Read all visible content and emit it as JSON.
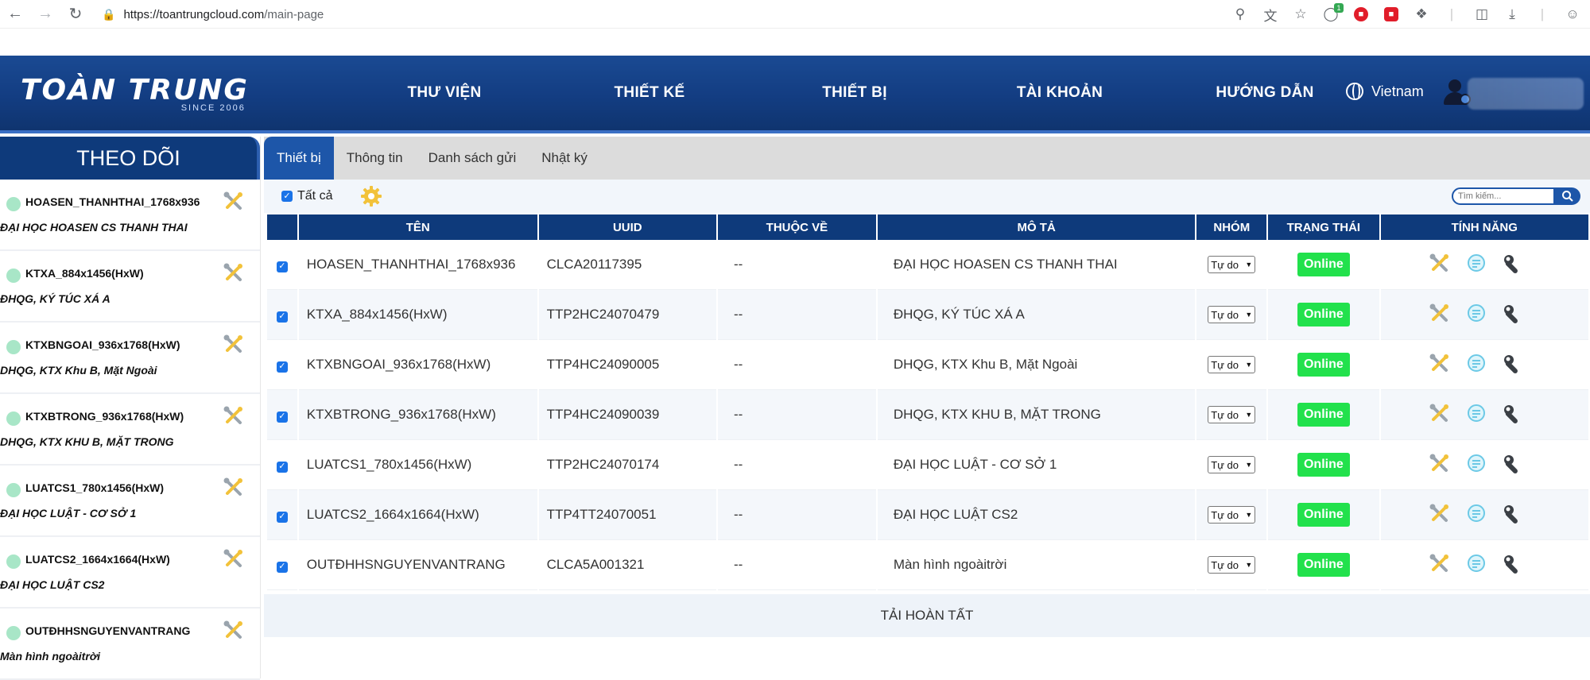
{
  "browser": {
    "url_host": "https://toantrungcloud.com",
    "url_path": "/main-page",
    "ext_badge": "1"
  },
  "header": {
    "logo_main": "TOÀN TRUNG",
    "logo_sub": "SINCE 2006",
    "nav": [
      "THƯ VIỆN",
      "THIẾT KẾ",
      "THIẾT BỊ",
      "TÀI KHOẢN",
      "HƯỚNG DẪN"
    ],
    "language": "Vietnam"
  },
  "sidebar": {
    "title": "THEO DÕI",
    "items": [
      {
        "name": "HOASEN_THANHTHAI_1768x936",
        "desc": "ĐẠI HỌC HOASEN CS THANH THAI"
      },
      {
        "name": "KTXA_884x1456(HxW)",
        "desc": "ĐHQG, KÝ TÚC XÁ A"
      },
      {
        "name": "KTXBNGOAI_936x1768(HxW)",
        "desc": "DHQG, KTX Khu B, Mặt Ngoài"
      },
      {
        "name": "KTXBTRONG_936x1768(HxW)",
        "desc": "DHQG, KTX KHU B, MẶT TRONG"
      },
      {
        "name": "LUATCS1_780x1456(HxW)",
        "desc": "ĐẠI HỌC LUẬT - CƠ SỞ 1"
      },
      {
        "name": "LUATCS2_1664x1664(HxW)",
        "desc": "ĐẠI HỌC LUẬT CS2"
      },
      {
        "name": "OUTĐHHSNGUYENVANTRANG",
        "desc": "Màn hình ngoàitrời"
      }
    ]
  },
  "tabs": [
    "Thiết bị",
    "Thông tin",
    "Danh sách gửi",
    "Nhật ký"
  ],
  "toolbar": {
    "select_all_label": "Tất cả",
    "search_placeholder": "Tìm kiếm..."
  },
  "table": {
    "headers": [
      "TÊN",
      "UUID",
      "THUỘC VỀ",
      "MÔ TẢ",
      "NHÓM",
      "TRẠNG THÁI",
      "TÍNH NĂNG"
    ],
    "rows": [
      {
        "name": "HOASEN_THANHTHAI_1768x936",
        "uuid": "CLCA20117395",
        "belong": "--",
        "desc": "ĐẠI HỌC HOASEN CS THANH THAI",
        "group": "Tự do",
        "status": "Online"
      },
      {
        "name": "KTXA_884x1456(HxW)",
        "uuid": "TTP2HC24070479",
        "belong": "--",
        "desc": "ĐHQG, KÝ TÚC XÁ A",
        "group": "Tự do",
        "status": "Online"
      },
      {
        "name": "KTXBNGOAI_936x1768(HxW)",
        "uuid": "TTP4HC24090005",
        "belong": "--",
        "desc": "DHQG, KTX Khu B, Mặt Ngoài",
        "group": "Tự do",
        "status": "Online"
      },
      {
        "name": "KTXBTRONG_936x1768(HxW)",
        "uuid": "TTP4HC24090039",
        "belong": "--",
        "desc": "DHQG, KTX KHU B, MẶT TRONG",
        "group": "Tự do",
        "status": "Online"
      },
      {
        "name": "LUATCS1_780x1456(HxW)",
        "uuid": "TTP2HC24070174",
        "belong": "--",
        "desc": "ĐẠI HỌC LUẬT - CƠ SỞ 1",
        "group": "Tự do",
        "status": "Online"
      },
      {
        "name": "LUATCS2_1664x1664(HxW)",
        "uuid": "TTP4TT24070051",
        "belong": "--",
        "desc": "ĐẠI HỌC LUẬT CS2",
        "group": "Tự do",
        "status": "Online"
      },
      {
        "name": "OUTĐHHSNGUYENVANTRANG",
        "uuid": "CLCA5A001321",
        "belong": "--",
        "desc": "Màn hình ngoàitrời",
        "group": "Tự do",
        "status": "Online"
      }
    ],
    "footer": "TẢI HOÀN TẤT"
  },
  "colors": {
    "header_blue": "#133d82",
    "tab_active": "#1d56a9",
    "online_green": "#22e14c",
    "status_dot": "#a8e6c7"
  }
}
